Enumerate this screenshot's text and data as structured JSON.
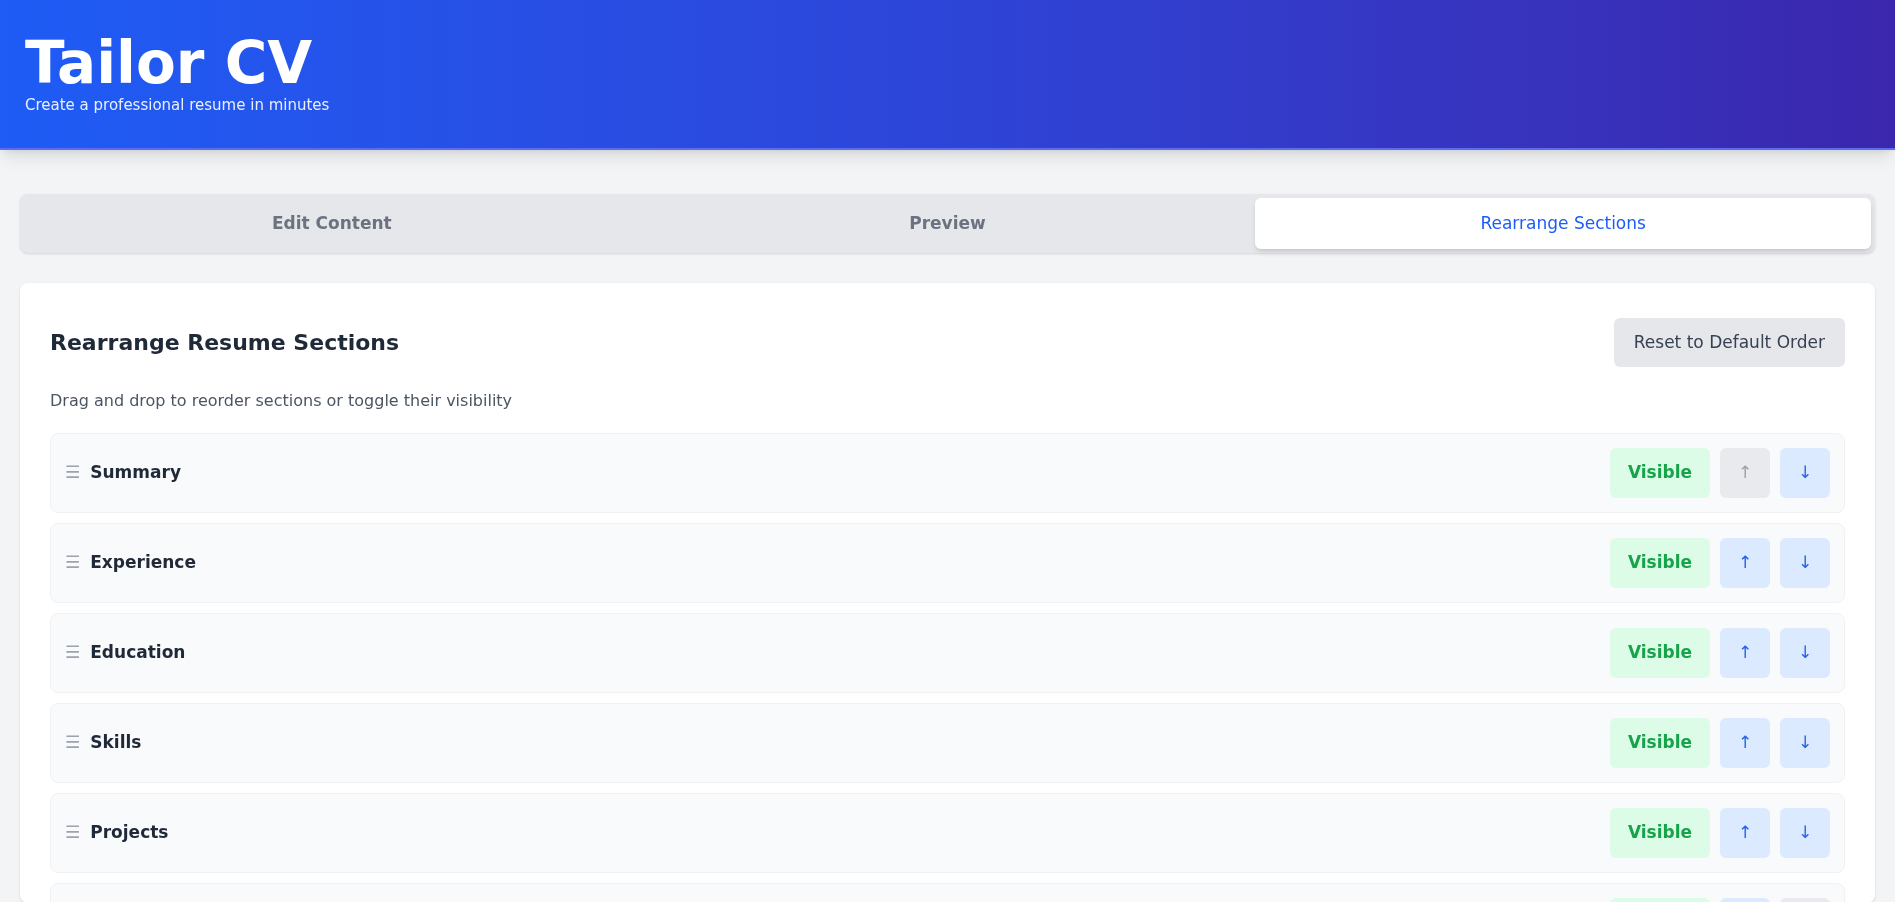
{
  "header": {
    "title": "Tailor CV",
    "subtitle": "Create a professional resume in minutes"
  },
  "tabs": [
    {
      "label": "Edit Content",
      "selected": false
    },
    {
      "label": "Preview",
      "selected": false
    },
    {
      "label": "Rearrange Sections",
      "selected": true
    }
  ],
  "panel": {
    "title": "Rearrange Resume Sections",
    "reset_button": "Reset to Default Order",
    "description": "Drag and drop to reorder sections or toggle their visibility"
  },
  "sections": [
    {
      "label": "Summary",
      "drag_handle": "☰",
      "visible": true,
      "visibility_label": "Visible",
      "up": "↑",
      "up_disabled": true,
      "down": "↓",
      "down_disabled": false
    },
    {
      "label": "Experience",
      "drag_handle": "☰",
      "visible": true,
      "visibility_label": "Visible",
      "up": "↑",
      "up_disabled": false,
      "down": "↓",
      "down_disabled": false
    },
    {
      "label": "Education",
      "drag_handle": "☰",
      "visible": true,
      "visibility_label": "Visible",
      "up": "↑",
      "up_disabled": false,
      "down": "↓",
      "down_disabled": false
    },
    {
      "label": "Skills",
      "drag_handle": "☰",
      "visible": true,
      "visibility_label": "Visible",
      "up": "↑",
      "up_disabled": false,
      "down": "↓",
      "down_disabled": false
    },
    {
      "label": "Projects",
      "drag_handle": "☰",
      "visible": true,
      "visibility_label": "Visible",
      "up": "↑",
      "up_disabled": false,
      "down": "↓",
      "down_disabled": false
    },
    {
      "visible": true,
      "up_disabled": false,
      "down_disabled": true
    }
  ]
}
